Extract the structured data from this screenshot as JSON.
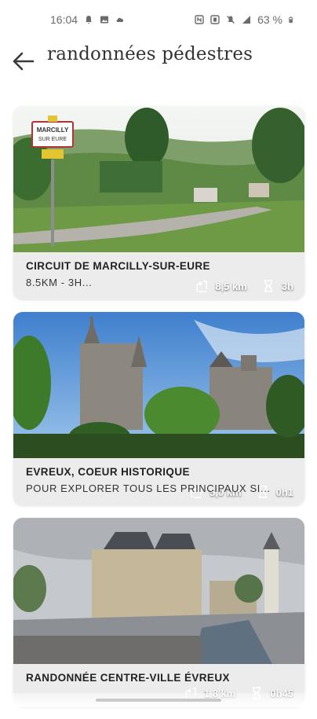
{
  "status": {
    "time": "16:04",
    "battery": "63 %"
  },
  "header": {
    "title": "randonnées pédestres"
  },
  "icons": {
    "back": "arrow-left-icon",
    "distance": "walking-route-icon",
    "duration": "hourglass-icon"
  },
  "cards": [
    {
      "title": "CIRCUIT DE MARCILLY-SUR-EURE",
      "subtitle": "8.5KM - 3H...",
      "distance": "8,5 km",
      "duration": "3h",
      "sign_line1": "MARCILLY",
      "sign_line2": "SUR EURE"
    },
    {
      "title": "EVREUX, COEUR HISTORIQUE",
      "subtitle": "POUR EXPLORER TOUS LES PRINCIPAUX SI...",
      "distance": "5,0 km",
      "duration": "0h1"
    },
    {
      "title": "RANDONNÉE CENTRE-VILLE ÉVREUX",
      "subtitle": "",
      "distance": "1,8 km",
      "duration": "0h45"
    }
  ]
}
